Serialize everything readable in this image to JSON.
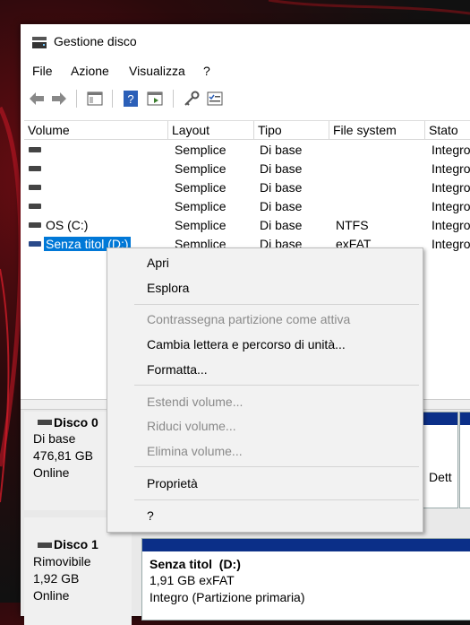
{
  "window": {
    "title": "Gestione disco",
    "app_icon": "disk-management-icon"
  },
  "menu": [
    "File",
    "Azione",
    "Visualizza",
    "?"
  ],
  "toolbar_icons": [
    "back-arrow-icon",
    "forward-arrow-icon",
    "console-tree-icon",
    "help-icon",
    "properties-icon",
    "key-icon",
    "checklist-icon"
  ],
  "columns": [
    "Volume",
    "Layout",
    "Tipo",
    "File system",
    "Stato"
  ],
  "volumes": [
    {
      "name": "",
      "layout": "Semplice",
      "tipo": "Di base",
      "fs": "",
      "stato": "Integro"
    },
    {
      "name": "",
      "layout": "Semplice",
      "tipo": "Di base",
      "fs": "",
      "stato": "Integro"
    },
    {
      "name": "",
      "layout": "Semplice",
      "tipo": "Di base",
      "fs": "",
      "stato": "Integro"
    },
    {
      "name": "",
      "layout": "Semplice",
      "tipo": "Di base",
      "fs": "",
      "stato": "Integro"
    },
    {
      "name": "OS (C:)",
      "layout": "Semplice",
      "tipo": "Di base",
      "fs": "NTFS",
      "stato": "Integro"
    },
    {
      "name": "Senza titol (D:)",
      "layout": "Semplice",
      "tipo": "Di base",
      "fs": "exFAT",
      "stato": "Integro",
      "selected": true
    }
  ],
  "context_menu": {
    "open": "Apri",
    "explore": "Esplora",
    "mark_active": "Contrassegna partizione come attiva",
    "change_letter": "Cambia lettera e percorso di unità...",
    "format": "Formatta...",
    "extend": "Estendi volume...",
    "shrink": "Riduci volume...",
    "delete": "Elimina volume...",
    "properties": "Proprietà",
    "help": "?"
  },
  "disks": [
    {
      "name": "Disco 0",
      "type": "Di base",
      "size": "476,81 GB",
      "status": "Online",
      "partial_label": "Dett"
    },
    {
      "name": "Disco 1",
      "type": "Rimovibile",
      "size": "1,92 GB",
      "status": "Online",
      "partition": {
        "name": "Senza titol  (D:)",
        "size_fs": "1,91 GB exFAT",
        "status": "Integro (Partizione primaria)"
      }
    }
  ],
  "colors": {
    "selection": "#0078d7",
    "partition_bar": "#0b2f88",
    "menu_bg": "#f2f2f2"
  }
}
